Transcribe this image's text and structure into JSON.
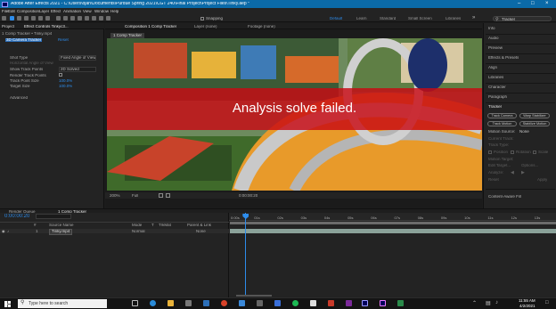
{
  "window": {
    "title": "Adobe After Effects 2021 - C:\\Users\\ojan\\Documents\\Purdue Spring 2021\\CGT 240\\Final Project\\Project Files\\Tinky.aep *"
  },
  "menu": [
    "File",
    "Edit",
    "Composition",
    "Layer",
    "Effect",
    "Animation",
    "View",
    "Window",
    "Help"
  ],
  "toolbar": {
    "snapping_label": "Snapping",
    "workspaces": [
      "Default",
      "Learn",
      "Standard",
      "Small Screen",
      "Libraries"
    ],
    "search_placeholder": "Tracker"
  },
  "effect_controls": {
    "tabs": [
      "Project",
      "Effect Controls  Tinkyc3...",
      "Composition  1 Comp Tracker"
    ],
    "header": "1 Comp Tracker • Tinky.mp4",
    "layer_name": "3D Camera Tracker",
    "reset_label": "Reset",
    "rows": [
      {
        "label": "Shot Type",
        "value": "Fixed Angle of View"
      },
      {
        "label": "Horizontal Angle of View",
        "value": ""
      },
      {
        "label": "Show Track Points",
        "value": "2D Solved"
      },
      {
        "label": "Render Track Points",
        "value": ""
      },
      {
        "label": "Track Point Size",
        "value": "100.0%"
      },
      {
        "label": "Target Size",
        "value": "100.0%"
      },
      {
        "label": "Advanced",
        "value": ""
      }
    ]
  },
  "viewer": {
    "tabs": [
      "Composition  1 Comp Tracker",
      "Layer  (none)",
      "Footage  (none)"
    ],
    "comp_tab": "1 Comp Tracker",
    "overlay_message": "Analysis solve failed.",
    "zoom": "200%",
    "resolution": "Full",
    "timecode": "0:00:00:20"
  },
  "right_panel": {
    "items": [
      "Info",
      "Audio",
      "Preview",
      "Effects & Presets",
      "Align",
      "Libraries",
      "Character",
      "Paragraph"
    ],
    "tracker": {
      "title": "Tracker",
      "buttons": [
        "Track Camera",
        "Warp Stabilizer",
        "Track Motion",
        "Stabilize Motion"
      ],
      "motion_source_label": "Motion Source:",
      "motion_source_value": "None",
      "dim_rows": [
        "Current Track:",
        "Track Type:",
        "Position",
        "Rotation",
        "Scale",
        "Motion Target:",
        "Edit Target...",
        "Options...",
        "Analyze:",
        "Reset",
        "Apply"
      ],
      "content_aware_fill": "Content-Aware Fill"
    }
  },
  "timeline": {
    "tabs": [
      "Render Queue",
      "1 Comp Tracker"
    ],
    "timecode": "0:00:00:20",
    "columns": [
      "#",
      "Source Name",
      "Mode",
      "T",
      "TrkMat",
      "Parent & Link"
    ],
    "layer": {
      "index": "1",
      "name": "Tinky.mp4",
      "mode": "Normal",
      "parent": "None"
    },
    "ruler_ticks": [
      "0:00s",
      "01s",
      "02s",
      "03s",
      "04s",
      "05s",
      "06s",
      "07s",
      "08s",
      "09s",
      "10s",
      "11s",
      "12s",
      "13s"
    ],
    "playhead_fraction": 0.05
  },
  "taskbar": {
    "search_placeholder": "Type here to search",
    "time": "11:55 AM",
    "date": "4/2/2021"
  },
  "colors": {
    "accent": "#2d8ceb",
    "error_overlay": "#c80a14",
    "title_bar": "#0b6aa8"
  }
}
